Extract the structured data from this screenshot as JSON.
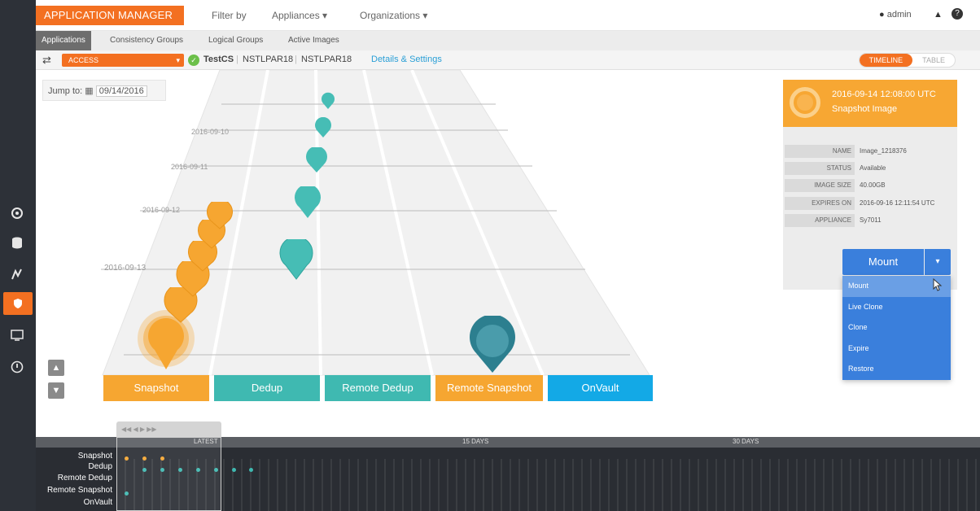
{
  "brand": "APPLICATION MANAGER",
  "topnav": {
    "filter_by": "Filter by",
    "appliances": "Appliances ▾",
    "organizations": "Organizations ▾"
  },
  "user": {
    "name": "admin"
  },
  "subtabs": [
    "Applications",
    "Consistency Groups",
    "Logical Groups",
    "Active Images"
  ],
  "breadcrumb": {
    "select_value": "ACCESS",
    "app": "TestCS",
    "host1": "NSTLPAR18",
    "host2": "NSTLPAR18",
    "link": "Details & Settings"
  },
  "view_toggle": {
    "timeline": "TIMELINE",
    "table": "TABLE"
  },
  "jump": {
    "label": "Jump to:",
    "date": "09/14/2016"
  },
  "lane_dates": [
    "2016-09-13",
    "2016-09-12",
    "2016-09-11",
    "2016-09-10"
  ],
  "lanes": [
    {
      "label": "Snapshot",
      "color": "#f6a631"
    },
    {
      "label": "Dedup",
      "color": "#3fb9b1"
    },
    {
      "label": "Remote Dedup",
      "color": "#3fb9b1"
    },
    {
      "label": "Remote Snapshot",
      "color": "#f6a631"
    },
    {
      "label": "OnVault",
      "color": "#13a9e6"
    }
  ],
  "details": {
    "timestamp": "2016-09-14 12:08:00 UTC",
    "type": "Snapshot Image",
    "fields": [
      {
        "key": "NAME",
        "value": "Image_1218376"
      },
      {
        "key": "STATUS",
        "value": "Available"
      },
      {
        "key": "IMAGE SIZE",
        "value": "40.00GB"
      },
      {
        "key": "EXPIRES ON",
        "value": "2016-09-16 12:11:54 UTC"
      },
      {
        "key": "APPLIANCE",
        "value": "Sy7011"
      }
    ],
    "action": "Mount"
  },
  "menu": [
    "Mount",
    "Live Clone",
    "Clone",
    "Expire",
    "Restore"
  ],
  "bottom": {
    "rows": [
      "Snapshot",
      "Dedup",
      "Remote Dedup",
      "Remote Snapshot",
      "OnVault"
    ],
    "ruler": [
      "LATEST",
      "15 DAYS",
      "30 DAYS"
    ],
    "nav": "◀◀ ◀        ▶ ▶▶"
  },
  "colors": {
    "accent": "#f37021",
    "snapshot": "#f6a631",
    "dedup": "#3fb9b1",
    "remote_snap_pin": "#2c7f8f",
    "onvault": "#13a9e6",
    "action": "#3a7fdc"
  }
}
